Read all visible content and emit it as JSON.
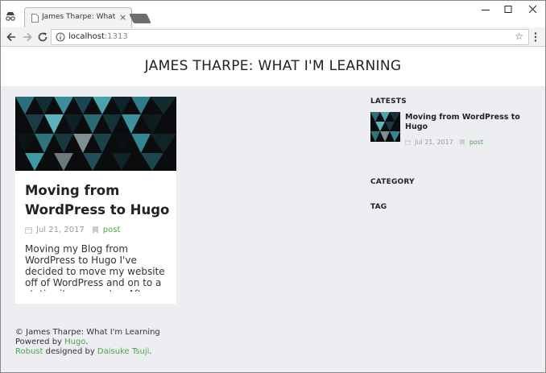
{
  "browser": {
    "tab_title": "James Tharpe: What I'm",
    "tab_close": "×",
    "url_host": "localhost",
    "url_port": ":1313",
    "star": "☆"
  },
  "site": {
    "title": "JAMES THARPE: WHAT I'M LEARNING"
  },
  "post": {
    "title": "Moving from WordPress to Hugo",
    "date": "Jul 21, 2017",
    "category": "post",
    "excerpt": "Moving my Blog from WordPress to Hugo I've decided to move my website off of WordPress and on to a static site generator. After"
  },
  "sidebar": {
    "latests_heading": "LATESTS",
    "latest_title": "Moving from WordPress to Hugo",
    "latest_date": "Jul 21, 2017",
    "latest_category": "post",
    "category_heading": "CATEGORY",
    "tag_heading": "TAG"
  },
  "footer": {
    "line1": "© James Tharpe: What I'm Learning",
    "powered_prefix": "Powered by ",
    "hugo": "Hugo",
    "powered_suffix": ".",
    "robust": "Robust",
    "designed_by": " designed by ",
    "author": "Daisuke Tsuji",
    "end": "."
  },
  "colors": {
    "link": "#4aa54a",
    "page_bg": "#eceef1",
    "toolbar_bg": "#f2f2f2"
  }
}
